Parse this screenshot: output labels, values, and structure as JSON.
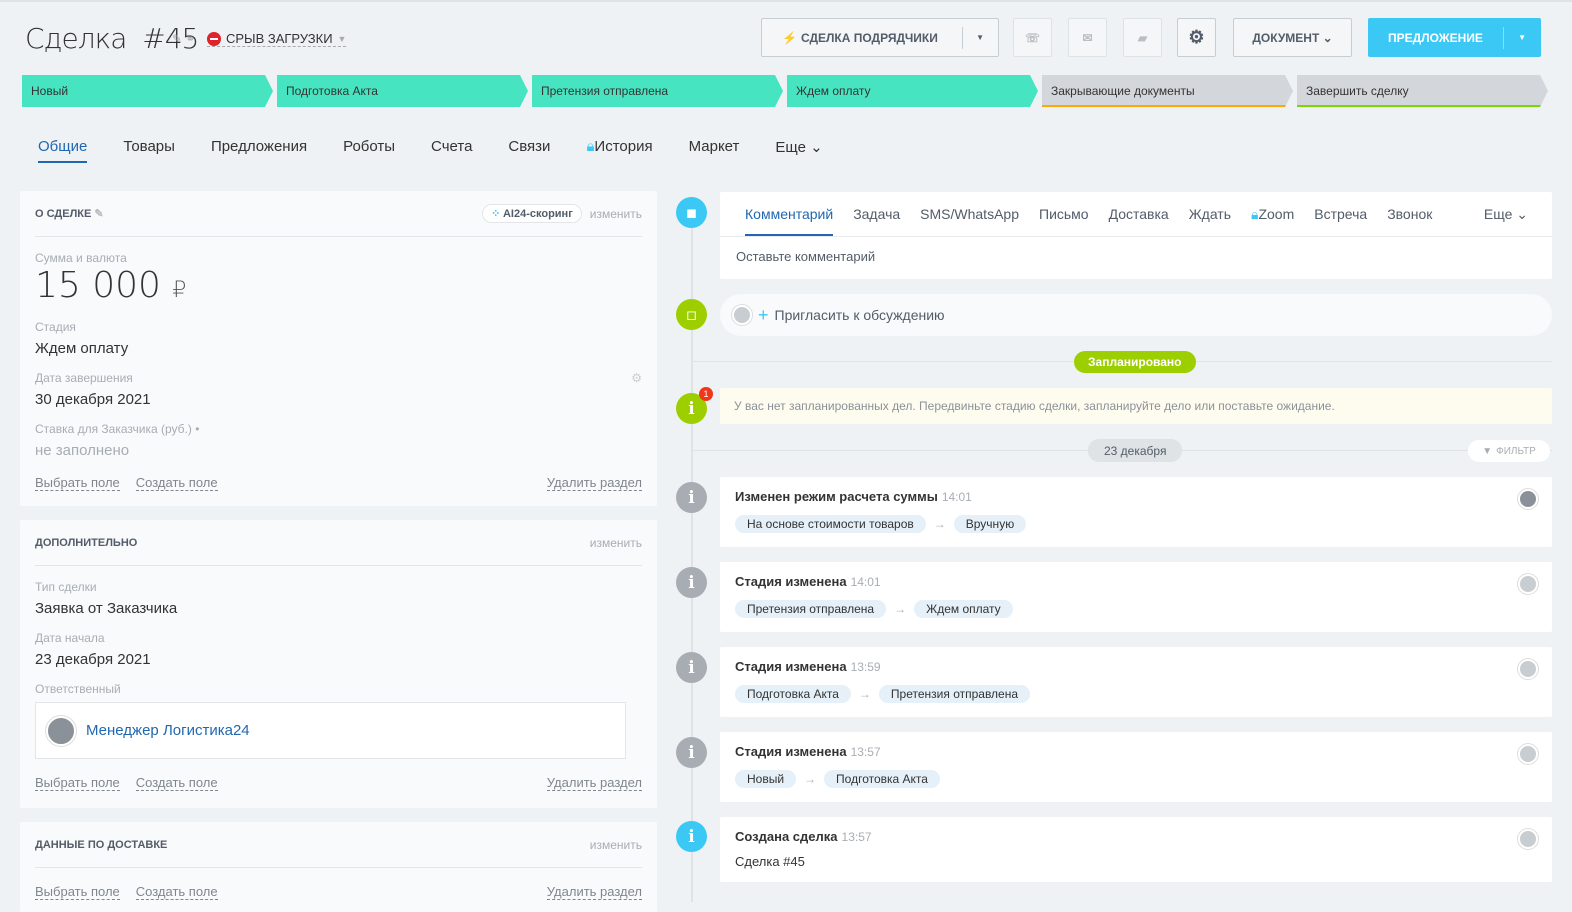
{
  "header": {
    "title": "Сделка",
    "number": "#45",
    "status": "СРЫВ ЗАГРУЗКИ",
    "btn_contractors": "СДЕЛКА ПОДРЯДЧИКИ",
    "btn_document": "ДОКУМЕНТ",
    "btn_offer": "ПРЕДЛОЖЕНИЕ"
  },
  "stages": [
    "Новый",
    "Подготовка Акта",
    "Претензия отправлена",
    "Ждем оплату",
    "Закрывающие документы",
    "Завершить сделку"
  ],
  "tabs": [
    "Общие",
    "Товары",
    "Предложения",
    "Роботы",
    "Счета",
    "Связи",
    "История",
    "Маркет",
    "Еще"
  ],
  "about": {
    "title": "О СДЕЛКЕ",
    "scoring": "AI24-скоринг",
    "change": "изменить",
    "amount_label": "Сумма и валюта",
    "amount": "15 000",
    "currency": "₽",
    "stage_label": "Стадия",
    "stage": "Ждем оплату",
    "close_label": "Дата завершения",
    "close": "30 декабря 2021",
    "rate_label": "Ставка для Заказчика (руб.) •",
    "rate": "не заполнено",
    "select_field": "Выбрать поле",
    "create_field": "Создать поле",
    "delete_section": "Удалить раздел"
  },
  "extra": {
    "title": "ДОПОЛНИТЕЛЬНО",
    "change": "изменить",
    "type_label": "Тип сделки",
    "type": "Заявка от Заказчика",
    "start_label": "Дата начала",
    "start": "23 декабря 2021",
    "resp_label": "Ответственный",
    "resp": "Менеджер Логистика24",
    "select_field": "Выбрать поле",
    "create_field": "Создать поле",
    "delete_section": "Удалить раздел"
  },
  "delivery": {
    "title": "ДАННЫЕ ПО ДОСТАВКЕ",
    "change": "изменить",
    "select_field": "Выбрать поле",
    "create_field": "Создать поле",
    "delete_section": "Удалить раздел"
  },
  "timeline": {
    "tabs": [
      "Комментарий",
      "Задача",
      "SMS/WhatsApp",
      "Письмо",
      "Доставка",
      "Ждать",
      "Zoom",
      "Встреча",
      "Звонок",
      "Еще"
    ],
    "comment_placeholder": "Оставьте комментарий",
    "invite": "Пригласить к обсуждению",
    "planned": "Запланировано",
    "badge": "1",
    "no_tasks": "У вас нет запланированных дел. Передвиньте стадию сделки, запланируйте дело или поставьте ожидание.",
    "date": "23 декабря",
    "filter": "ФИЛЬТР",
    "events": [
      {
        "title": "Изменен режим расчета суммы",
        "time": "14:01",
        "from": "На основе стоимости товаров",
        "to": "Вручную"
      },
      {
        "title": "Стадия изменена",
        "time": "14:01",
        "from": "Претензия отправлена",
        "to": "Ждем оплату"
      },
      {
        "title": "Стадия изменена",
        "time": "13:59",
        "from": "Подготовка Акта",
        "to": "Претензия отправлена"
      },
      {
        "title": "Стадия изменена",
        "time": "13:57",
        "from": "Новый",
        "to": "Подготовка Акта"
      }
    ],
    "created": {
      "title": "Создана сделка",
      "time": "13:57",
      "text": "Сделка #45"
    }
  }
}
